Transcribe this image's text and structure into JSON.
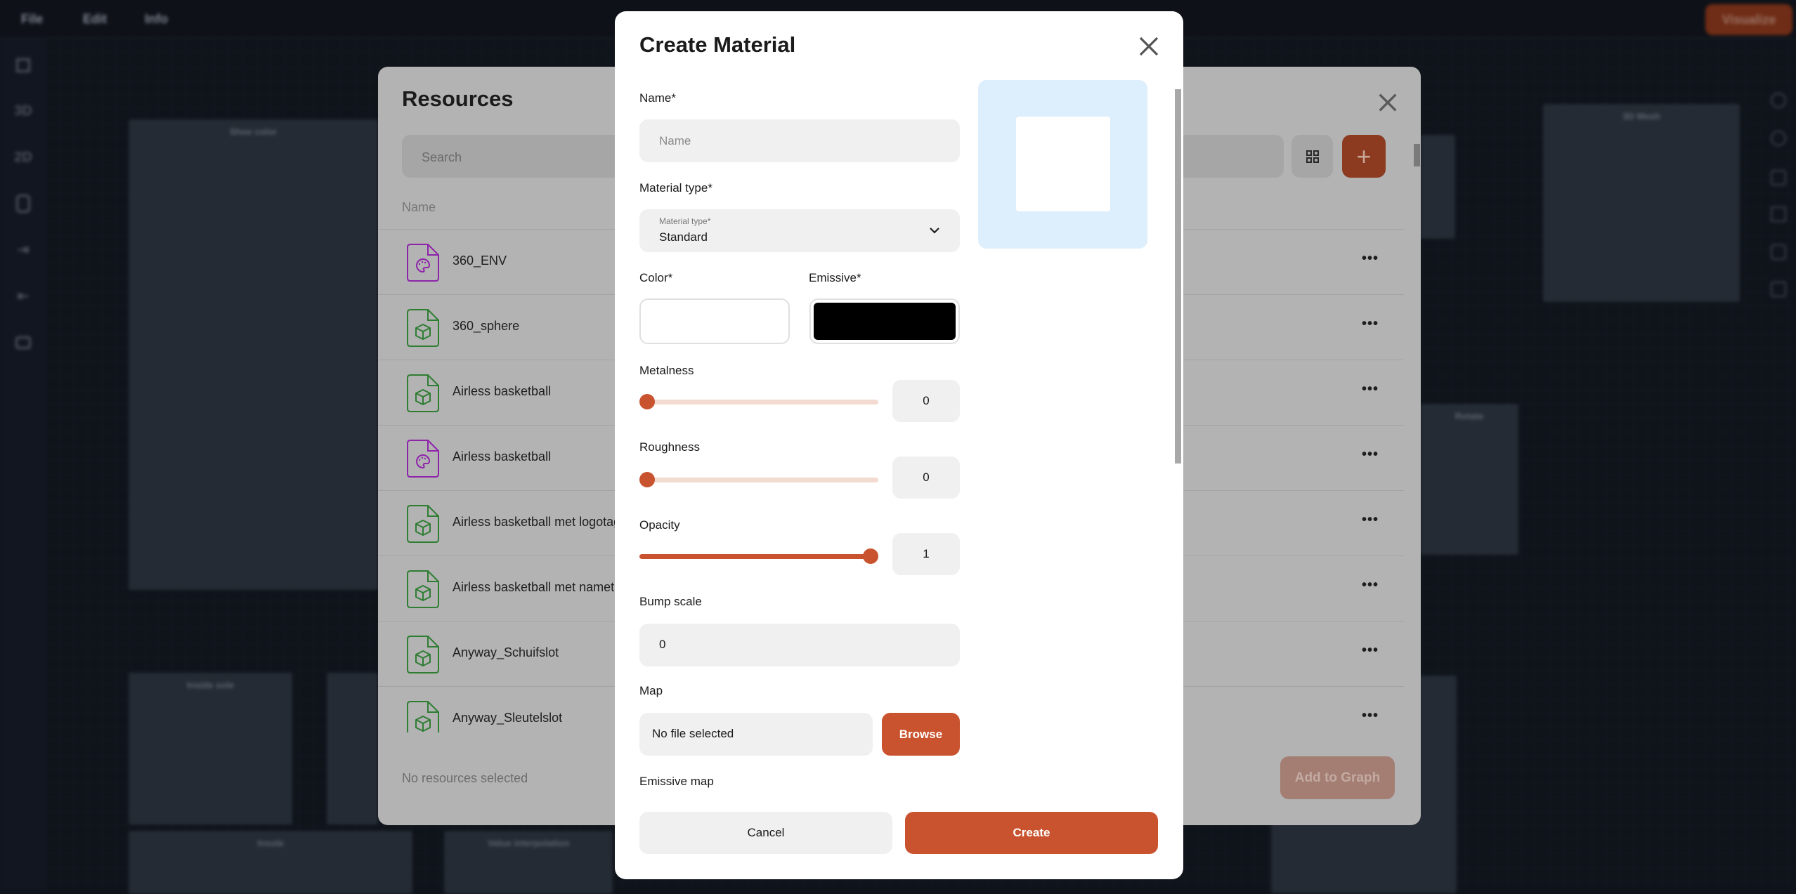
{
  "topbar": {
    "menu": [
      "File",
      "Edit",
      "Info"
    ],
    "visualize_label": "Visualize"
  },
  "left_sidebar": {
    "labels": [
      "3D",
      "2D"
    ]
  },
  "background_nodes": {
    "shoe_color": "Shoe color",
    "mesh": "3D Mesh",
    "rotate": "Rotate",
    "inside_sole": "Inside sole",
    "insole": "Insole",
    "value_interpolation": "Value interpolation"
  },
  "resources": {
    "title": "Resources",
    "search_placeholder": "Search",
    "column_name": "Name",
    "items": [
      {
        "name": "360_ENV",
        "type": "material"
      },
      {
        "name": "360_sphere",
        "type": "model"
      },
      {
        "name": "Airless basketball",
        "type": "model"
      },
      {
        "name": "Airless basketball",
        "type": "material"
      },
      {
        "name": "Airless basketball met logotag",
        "type": "model"
      },
      {
        "name": "Airless basketball met nametag",
        "type": "model"
      },
      {
        "name": "Anyway_Schuifslot",
        "type": "model"
      },
      {
        "name": "Anyway_Sleutelslot",
        "type": "model"
      }
    ],
    "more_label": "•••",
    "status": "No resources selected",
    "add_button": "Add to Graph",
    "plus_label": "+"
  },
  "create_material": {
    "title": "Create Material",
    "name_label": "Name*",
    "name_placeholder": "Name",
    "name_value": "",
    "type_label": "Material type*",
    "type_floating_label": "Material type*",
    "type_value": "Standard",
    "color_label": "Color*",
    "color_value": "#ffffff",
    "emissive_label": "Emissive*",
    "emissive_value": "#000000",
    "metalness_label": "Metalness",
    "metalness_value": "0",
    "roughness_label": "Roughness",
    "roughness_value": "0",
    "opacity_label": "Opacity",
    "opacity_value": "1",
    "slider_range": [
      0,
      1
    ],
    "bump_label": "Bump scale",
    "bump_value": "0",
    "map_label": "Map",
    "map_file": "No file selected",
    "browse_label": "Browse",
    "emissive_map_label": "Emissive map",
    "cancel_label": "Cancel",
    "create_label": "Create"
  },
  "colors": {
    "accent": "#c9532e",
    "material_icon": "#8e24aa",
    "model_icon": "#2e7d32",
    "preview_bg": "#ddeefc"
  }
}
